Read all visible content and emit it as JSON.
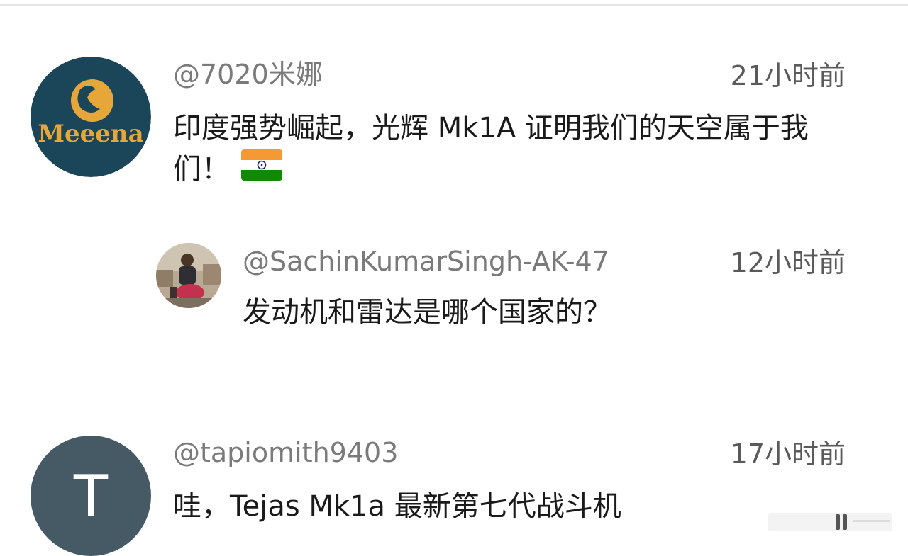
{
  "comments": [
    {
      "handle": "@7020米娜",
      "time": "21小时前",
      "text": "印度强势崛起，光辉 Mk1A 证明我们的天空属于我们！",
      "avatar_label": "Meeena",
      "avatar_bg": "#1b4558",
      "avatar_fg": "#e6a63a",
      "emoji": "india-flag"
    },
    {
      "handle": "@SachinKumarSingh-AK-47",
      "time": "12小时前",
      "text": "发动机和雷达是哪个国家的？"
    },
    {
      "handle": "@tapiomith9403",
      "time": "17小时前",
      "text": "哇，Tejas Mk1a 最新第七代战斗机",
      "avatar_letter": "T",
      "avatar_bg": "#455a64"
    }
  ],
  "colors": {
    "handle": "#7a7a7a",
    "time": "#5a5a5a",
    "text": "#1a1a1a"
  }
}
